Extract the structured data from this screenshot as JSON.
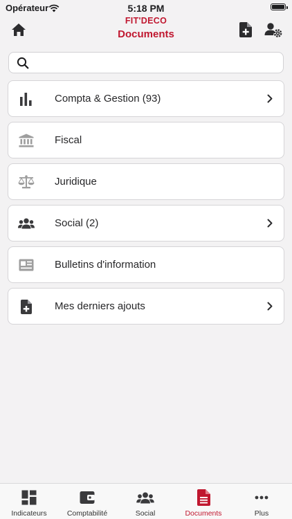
{
  "status_bar": {
    "carrier": "Opérateur",
    "time": "5:18 PM"
  },
  "header": {
    "brand": "FIT'DECO",
    "title": "Documents"
  },
  "search": {
    "placeholder": ""
  },
  "items": [
    {
      "label": "Compta & Gestion (93)",
      "icon": "bar-chart-icon",
      "has_chevron": true,
      "enabled": true
    },
    {
      "label": "Fiscal",
      "icon": "bank-icon",
      "has_chevron": false,
      "enabled": false
    },
    {
      "label": "Juridique",
      "icon": "balance-scale-icon",
      "has_chevron": false,
      "enabled": false
    },
    {
      "label": "Social (2)",
      "icon": "users-icon",
      "has_chevron": true,
      "enabled": true
    },
    {
      "label": "Bulletins d'information",
      "icon": "newspaper-icon",
      "has_chevron": false,
      "enabled": false
    },
    {
      "label": "Mes derniers ajouts",
      "icon": "file-plus-icon",
      "has_chevron": true,
      "enabled": true
    }
  ],
  "tabs": [
    {
      "label": "Indicateurs",
      "icon": "dashboard-icon",
      "active": false
    },
    {
      "label": "Comptabilité",
      "icon": "wallet-icon",
      "active": false
    },
    {
      "label": "Social",
      "icon": "users-icon",
      "active": false
    },
    {
      "label": "Documents",
      "icon": "document-icon",
      "active": true
    },
    {
      "label": "Plus",
      "icon": "more-icon",
      "active": false
    }
  ],
  "colors": {
    "accent": "#c0172f",
    "icon_active": "#3a3a3c",
    "icon_disabled": "#9e9e9e",
    "background": "#f3f2f3"
  }
}
